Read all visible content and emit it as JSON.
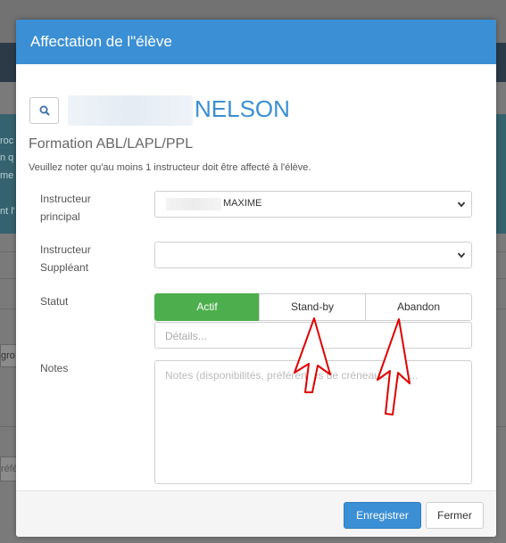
{
  "modal": {
    "title": "Affectation de l\"élève",
    "student_name": "NELSON",
    "formation": "Formation ABL/LAPL/PPL",
    "notice": "Veuillez noter qu'au moins 1 instructeur doit être affecté à l'élève."
  },
  "fields": {
    "main_instructor_label_line1": "Instructeur",
    "main_instructor_label_line2": "principal",
    "main_instructor_value": "MAXIME",
    "substitute_label_line1": "Instructeur",
    "substitute_label_line2": "Suppléant",
    "substitute_value": "",
    "status_label": "Statut",
    "notes_label": "Notes"
  },
  "status": {
    "options": [
      "Actif",
      "Stand-by",
      "Abandon"
    ],
    "selected": "Actif",
    "details_placeholder": "Détails..."
  },
  "notes": {
    "placeholder": "Notes (disponibilités, préférences de créneaux, etc)..."
  },
  "footer": {
    "save_label": "Enregistrer",
    "close_label": "Fermer"
  },
  "background": {
    "info_fragments": [
      "roc",
      "n q",
      "me",
      "nt l'"
    ],
    "select_fragment": "gro",
    "input_fragment": "réfé"
  },
  "colors": {
    "header": "#3b8fd4",
    "active_status": "#4cae4c",
    "annotation_arrow": "#e00000"
  },
  "icons": {
    "search": "search-icon",
    "dropdown": "chevron-down-icon"
  }
}
